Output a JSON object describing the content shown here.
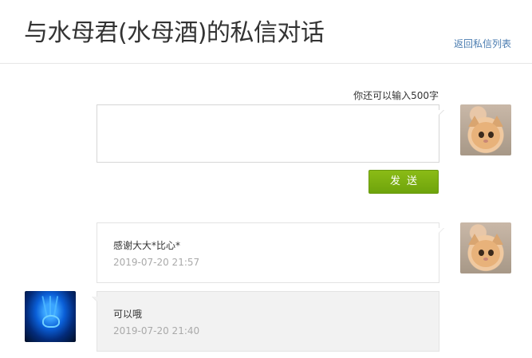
{
  "header": {
    "title": "与水母君(水母酒)的私信对话",
    "back_link": "返回私信列表"
  },
  "compose": {
    "remaining_label": "你还可以输入500字",
    "value": "",
    "send_label": "发送"
  },
  "messages": [
    {
      "direction": "sent",
      "text": "感谢大大*比心*",
      "time": "2019-07-20 21:57",
      "avatar": "cat-avatar"
    },
    {
      "direction": "received",
      "text": "可以哦",
      "time": "2019-07-20 21:40",
      "avatar": "jellyfish-avatar"
    }
  ],
  "colors": {
    "send_button": "#7aad10",
    "link": "#4a7cb0",
    "timestamp": "#aaaaaa",
    "received_bg": "#f2f2f2"
  }
}
